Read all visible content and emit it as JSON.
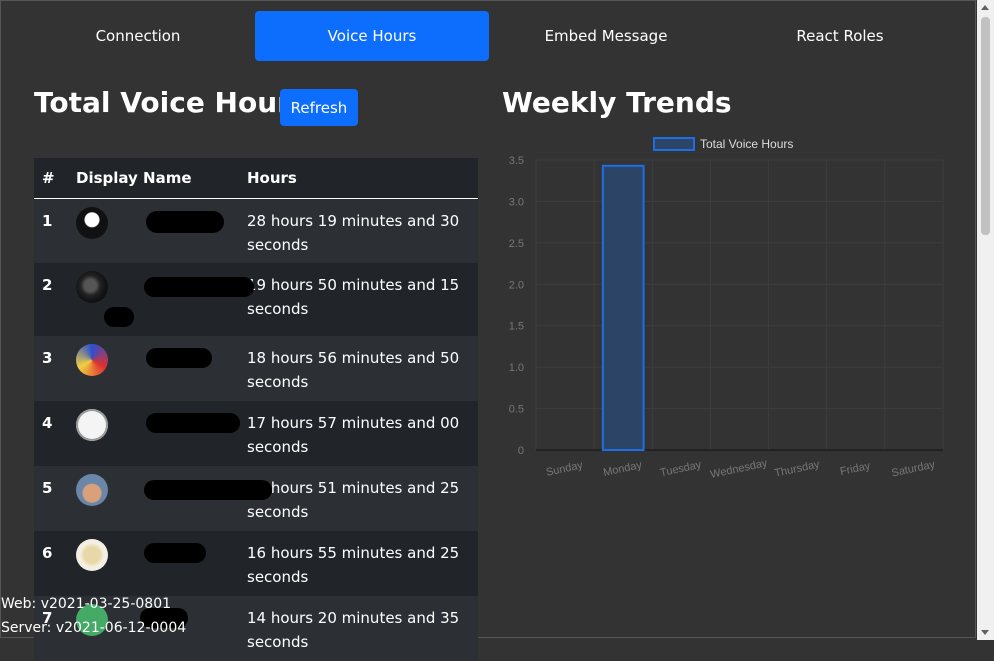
{
  "tabs": [
    {
      "label": "Connection"
    },
    {
      "label": "Voice Hours"
    },
    {
      "label": "Embed Message"
    },
    {
      "label": "React Roles"
    }
  ],
  "left": {
    "title": "Total Voice Hours",
    "refresh_label": "Refresh",
    "table": {
      "headers": [
        "#",
        "Display Name",
        "Hours"
      ],
      "rows": [
        {
          "rank": "1",
          "hours": "28 hours 19 minutes and 30 seconds"
        },
        {
          "rank": "2",
          "hours": "19 hours 50 minutes and 15 seconds"
        },
        {
          "rank": "3",
          "hours": "18 hours 56 minutes and 50 seconds"
        },
        {
          "rank": "4",
          "hours": "17 hours 57 minutes and 00 seconds"
        },
        {
          "rank": "5",
          "hours": "17 hours 51 minutes and 25 seconds"
        },
        {
          "rank": "6",
          "hours": "16 hours 55 minutes and 25 seconds"
        },
        {
          "rank": "7",
          "hours": "14 hours 20 minutes and 35 seconds"
        }
      ]
    }
  },
  "right": {
    "title": "Weekly Trends"
  },
  "chart_data": {
    "type": "bar",
    "categories": [
      "Sunday",
      "Monday",
      "Tuesday",
      "Wednesday",
      "Thursday",
      "Friday",
      "Saturday"
    ],
    "series": [
      {
        "name": "Total Voice Hours",
        "values": [
          0,
          3.43,
          0,
          0,
          0,
          0,
          0
        ]
      }
    ],
    "yticks": [
      "0",
      "0.5",
      "1.0",
      "1.5",
      "2.0",
      "2.5",
      "3.0",
      "3.5"
    ],
    "ylim": [
      0,
      3.5
    ],
    "legend": "top",
    "grid": true,
    "colors": {
      "border": "#1e6ee6",
      "fill": "#2c4466"
    }
  },
  "footer": {
    "web_version": "Web: v2021-03-25-0801",
    "server_version": "Server: v2021-06-12-0004"
  }
}
